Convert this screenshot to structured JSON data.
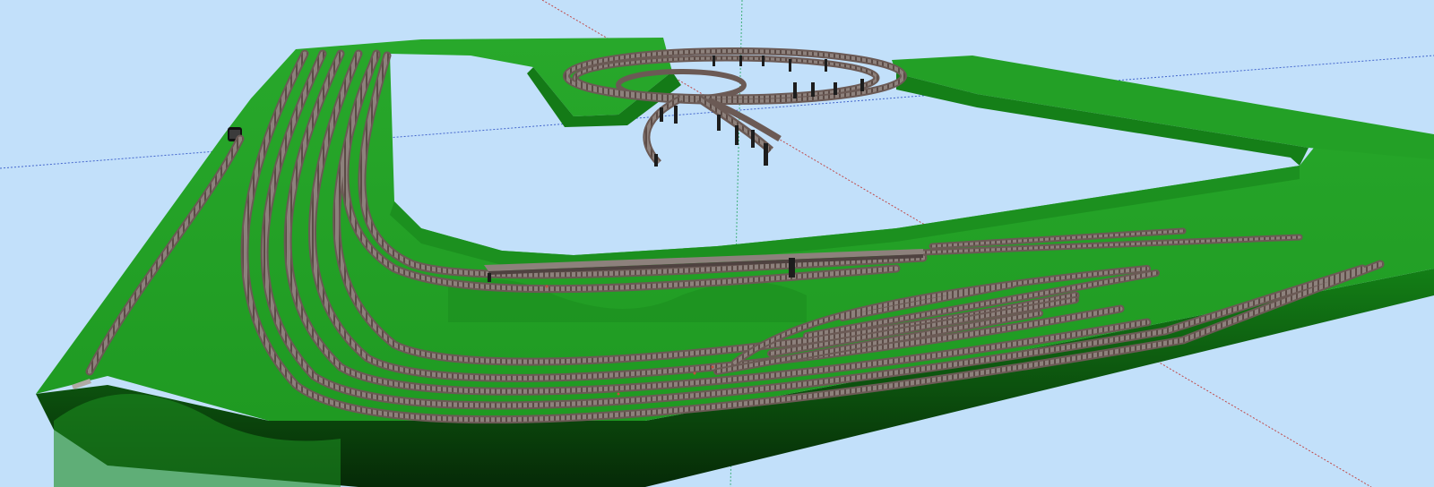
{
  "viewport": {
    "background": "#c2e0fa",
    "axis_colors": {
      "red": "#c04a4a",
      "green": "#3fae7a",
      "blue": "#4466cc"
    }
  },
  "scene": {
    "terrain_colors": {
      "top": "#24a327",
      "edge_dark": "#0a3a0b",
      "edge_mid": "#137f16",
      "shadow": "#1b7d1e"
    },
    "track_colors": {
      "sleepers": "#6b5a55",
      "ballast": "#a09a96",
      "rail": "#3a2c2a",
      "pier": "#1d1d1d"
    }
  }
}
